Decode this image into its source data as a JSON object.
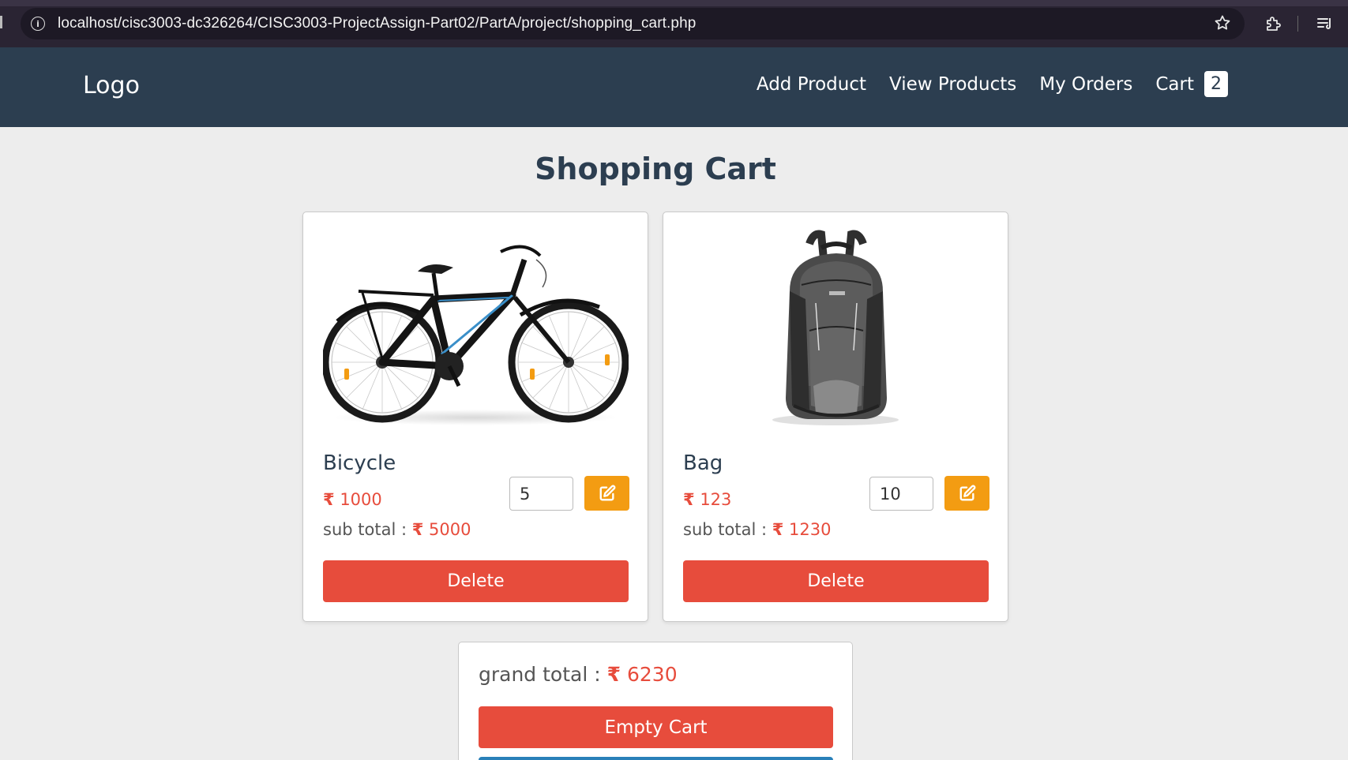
{
  "browser": {
    "url": "localhost/cisc3003-dc326264/CISC3003-ProjectAssign-Part02/PartA/project/shopping_cart.php"
  },
  "header": {
    "logo": "Logo",
    "nav": {
      "add_product": "Add Product",
      "view_products": "View Products",
      "my_orders": "My Orders",
      "cart": "Cart",
      "cart_count": "2"
    }
  },
  "page": {
    "title": "Shopping Cart"
  },
  "currency_symbol": "₹",
  "items": [
    {
      "name": "Bicycle",
      "price": "1000",
      "quantity": "5",
      "subtotal_label": "sub total :",
      "subtotal": "5000",
      "delete_label": "Delete",
      "image": "bicycle"
    },
    {
      "name": "Bag",
      "price": "123",
      "quantity": "10",
      "subtotal_label": "sub total :",
      "subtotal": "1230",
      "delete_label": "Delete",
      "image": "backpack"
    }
  ],
  "summary": {
    "grand_total_label": "grand total :",
    "grand_total": "6230",
    "empty_cart_label": "Empty Cart"
  },
  "colors": {
    "navbar": "#2c3e50",
    "accent_red": "#e74c3c",
    "edit_orange": "#f39c12",
    "checkout_blue": "#2980b9"
  }
}
